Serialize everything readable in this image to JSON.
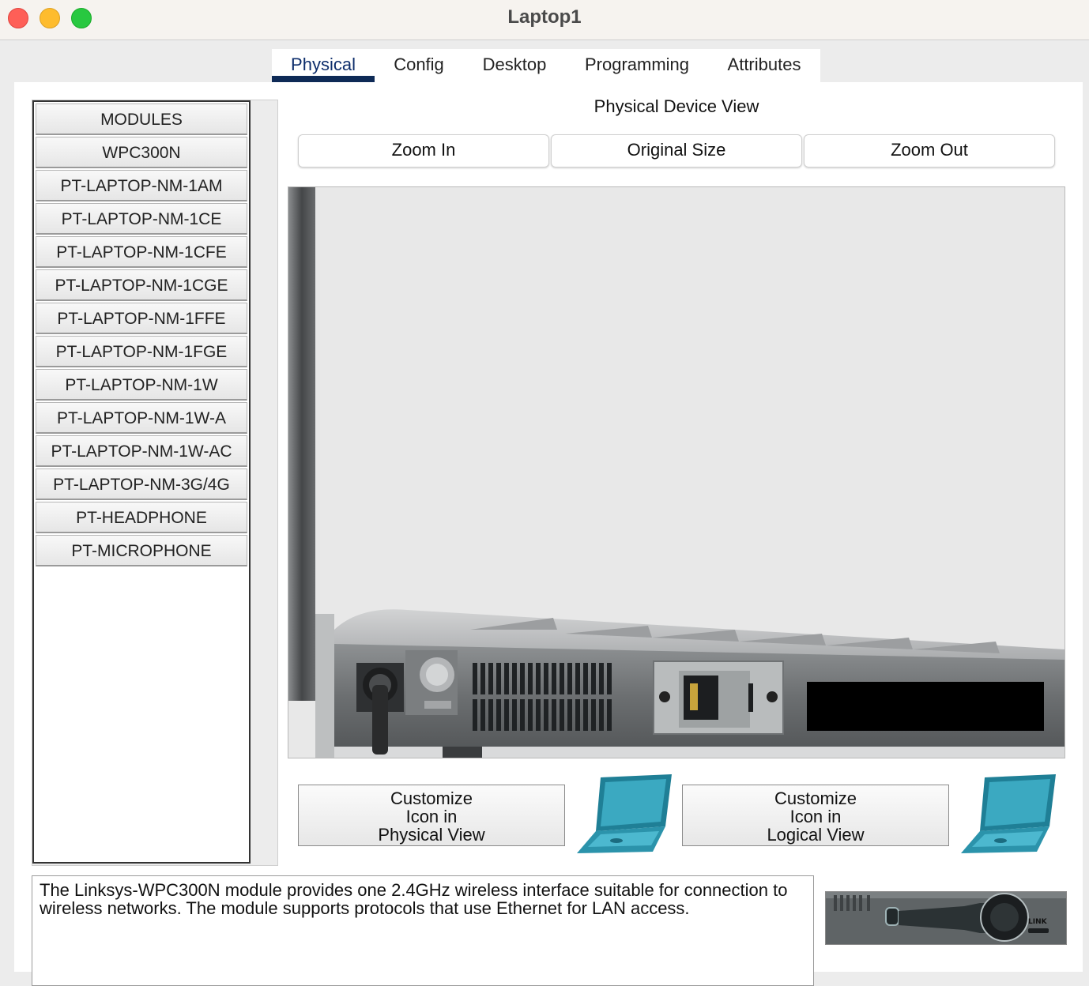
{
  "window": {
    "title": "Laptop1"
  },
  "tabs": [
    {
      "label": "Physical",
      "active": true
    },
    {
      "label": "Config",
      "active": false
    },
    {
      "label": "Desktop",
      "active": false
    },
    {
      "label": "Programming",
      "active": false
    },
    {
      "label": "Attributes",
      "active": false
    }
  ],
  "modules": {
    "items": [
      "MODULES",
      "WPC300N",
      "PT-LAPTOP-NM-1AM",
      "PT-LAPTOP-NM-1CE",
      "PT-LAPTOP-NM-1CFE",
      "PT-LAPTOP-NM-1CGE",
      "PT-LAPTOP-NM-1FFE",
      "PT-LAPTOP-NM-1FGE",
      "PT-LAPTOP-NM-1W",
      "PT-LAPTOP-NM-1W-A",
      "PT-LAPTOP-NM-1W-AC",
      "PT-LAPTOP-NM-3G/4G",
      "PT-HEADPHONE",
      "PT-MICROPHONE"
    ]
  },
  "physical_view": {
    "title": "Physical Device View",
    "zoom_in": "Zoom In",
    "original_size": "Original Size",
    "zoom_out": "Zoom Out"
  },
  "customize": {
    "physical": {
      "line1": "Customize",
      "line2": "Icon in",
      "line3": "Physical View"
    },
    "logical": {
      "line1": "Customize",
      "line2": "Icon in",
      "line3": "Logical View"
    }
  },
  "description": "The Linksys-WPC300N module provides one 2.4GHz wireless interface suitable for connection to wireless networks. The module supports protocols that use Ethernet for LAN access.",
  "thumbnail": {
    "label": "LINK"
  },
  "colors": {
    "active_tab": "#0e2a56",
    "laptop_icon": "#2f9bb3",
    "close": "#fe5f57",
    "minimize": "#febc2e",
    "maximize": "#28c840"
  }
}
